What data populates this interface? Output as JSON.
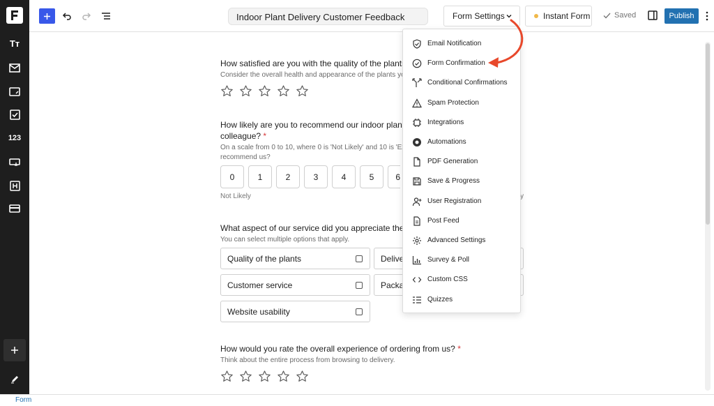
{
  "header": {
    "form_title": "Indoor Plant Delivery Customer Feedback",
    "form_settings_label": "Form Settings",
    "instant_form_label": "Instant Form",
    "saved_label": "Saved",
    "publish_label": "Publish"
  },
  "sidebar": {
    "items": [
      {
        "icon": "text-format-icon",
        "label": "Tт"
      },
      {
        "icon": "mail-icon"
      },
      {
        "icon": "textarea-icon"
      },
      {
        "icon": "checkbox-icon"
      },
      {
        "icon": "number-icon",
        "label": "123"
      },
      {
        "icon": "input-icon"
      },
      {
        "icon": "heading-icon"
      },
      {
        "icon": "card-icon"
      }
    ]
  },
  "settings_menu": {
    "items": [
      {
        "label": "Email Notification",
        "icon": "shield-check-icon"
      },
      {
        "label": "Form Confirmation",
        "icon": "check-circle-icon"
      },
      {
        "label": "Conditional Confirmations",
        "icon": "branch-icon"
      },
      {
        "label": "Spam Protection",
        "icon": "warning-icon"
      },
      {
        "label": "Integrations",
        "icon": "chip-icon"
      },
      {
        "label": "Automations",
        "icon": "automation-icon"
      },
      {
        "label": "PDF Generation",
        "icon": "document-icon"
      },
      {
        "label": "Save & Progress",
        "icon": "floppy-icon"
      },
      {
        "label": "User Registration",
        "icon": "user-add-icon"
      },
      {
        "label": "Post Feed",
        "icon": "post-icon"
      },
      {
        "label": "Advanced Settings",
        "icon": "gear-icon"
      },
      {
        "label": "Survey & Poll",
        "icon": "bar-chart-icon"
      },
      {
        "label": "Custom CSS",
        "icon": "code-icon"
      },
      {
        "label": "Quizzes",
        "icon": "quiz-icon"
      }
    ]
  },
  "form": {
    "q1": {
      "question": "How satisfied are you with the quality of the plants de",
      "help": "Consider the overall health and appearance of the plants you"
    },
    "q2": {
      "question_line1": "How likely are you to recommend our indoor plant de",
      "question_line2": "colleague?",
      "required": "*",
      "help_line1": "On a scale from 0 to 10, where 0 is 'Not Likely' and 10 is 'Ext",
      "help_line2": "recommend us?",
      "scale": [
        "0",
        "1",
        "2",
        "3",
        "4",
        "5",
        "6"
      ],
      "low_label": "Not Likely",
      "high_label_fragment": "y"
    },
    "q3": {
      "question": "What aspect of our service did you appreciate the m",
      "help": "You can select multiple options that apply.",
      "options": [
        "Quality of the plants",
        "Deliver",
        "Customer service",
        "Packa",
        "Website usability"
      ]
    },
    "q4": {
      "question": "How would you rate the overall experience of ordering from us?",
      "required": "*",
      "help": "Think about the entire process from browsing to delivery."
    }
  },
  "footer": {
    "breadcrumb": "Form"
  },
  "colors": {
    "accent": "#3858e9",
    "publish": "#2271b1",
    "sidebar_bg": "#1e1e1e",
    "arrow": "#e8482b",
    "required": "#d63638"
  }
}
